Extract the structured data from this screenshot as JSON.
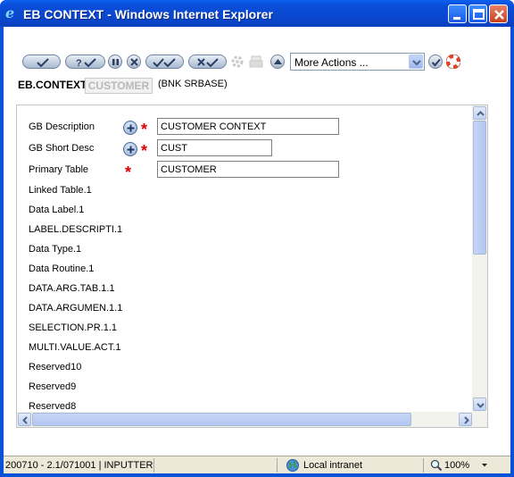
{
  "window": {
    "title": "EB CONTEXT - Windows Internet Explorer"
  },
  "toolbar": {
    "buttons": [
      {
        "name": "commit-button"
      },
      {
        "name": "validate-button"
      },
      {
        "name": "hold-button"
      },
      {
        "name": "delete-button"
      },
      {
        "name": "authorise-button"
      },
      {
        "name": "reverse-button"
      },
      {
        "name": "settings-icon"
      },
      {
        "name": "print-icon"
      },
      {
        "name": "up-button"
      }
    ],
    "actions_select": "More Actions ..."
  },
  "context": {
    "label": "EB.CONTEXT",
    "id_field": "CUSTOMER",
    "subtitle": "(BNK SRBASE)"
  },
  "form": {
    "rows": [
      {
        "label": "GB Description",
        "value": "CUSTOMER CONTEXT"
      },
      {
        "label": "GB Short Desc",
        "value": "CUST"
      },
      {
        "label": "Primary Table",
        "value": "CUSTOMER"
      },
      {
        "label": "Linked Table.1"
      },
      {
        "label": "Data Label.1"
      },
      {
        "label": "LABEL.DESCRIPTI.1"
      },
      {
        "label": "Data Type.1"
      },
      {
        "label": "Data Routine.1"
      },
      {
        "label": "DATA.ARG.TAB.1.1"
      },
      {
        "label": "DATA.ARGUMEN.1.1"
      },
      {
        "label": "SELECTION.PR.1.1"
      },
      {
        "label": "MULTI.VALUE.ACT.1"
      },
      {
        "label": "Reserved10"
      },
      {
        "label": "Reserved9"
      },
      {
        "label": "Reserved8"
      }
    ],
    "required_marker": "*"
  },
  "status": {
    "left": "200710 - 2.1/071001 | INPUTTER",
    "zone": "Local intranet",
    "zoom": "100%"
  },
  "colors": {
    "titlebar": "#0a48d0",
    "required": "#e00000",
    "statusbar": "#ece9d8"
  }
}
